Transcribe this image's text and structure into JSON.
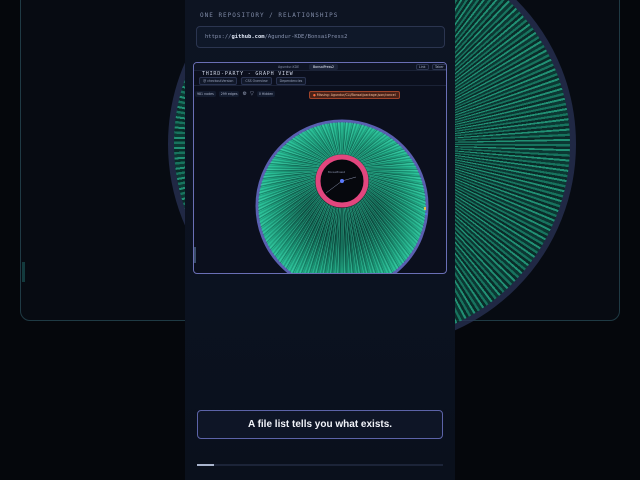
{
  "section_label": "ONE REPOSITORY / RELATIONSHIPS",
  "url": {
    "prefix": "https://",
    "host": "github.com",
    "path": "/Agundur-KDE/BonsaiPress2"
  },
  "app": {
    "tabs": [
      "Agundur-KDE",
      "BonsaiPress2"
    ],
    "window_controls": [
      "Link",
      "Taber"
    ],
    "title": "THIRD-PARTY - GRAPH VIEW",
    "toolbar": [
      "@ checkoutVersion",
      "CSS Overview",
      "Dependencies"
    ],
    "stats": [
      {
        "value": "981",
        "label": "nodes"
      },
      {
        "value": "299",
        "label": "edges"
      }
    ],
    "filter_label": "0 Hidden",
    "alert": "Missing: Agundur/CLI/Bonsai/package.json/cancel",
    "center_label": "BonsaiPress2"
  },
  "caption": "A file list tells you what exists.",
  "progress": 0.07,
  "colors": {
    "accent": "#e2467e",
    "graph_green": "#2bc49a",
    "ring": "#5a5fb0",
    "border": "#6a6fb5"
  },
  "icons": [
    "gear-icon",
    "filter-icon"
  ]
}
